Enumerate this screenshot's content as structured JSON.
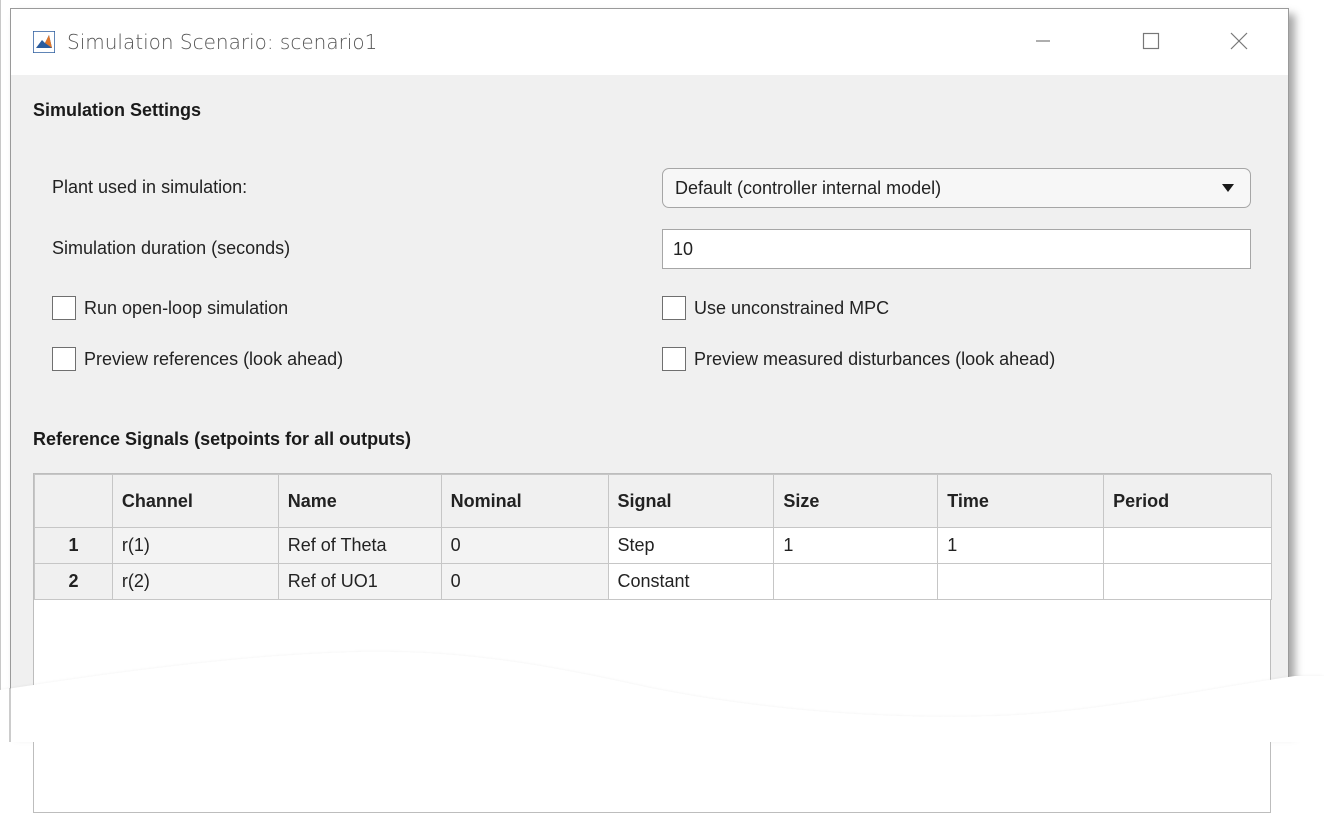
{
  "window": {
    "title": "Simulation Scenario: scenario1"
  },
  "settings": {
    "section_title": "Simulation Settings",
    "plant_label": "Plant used in simulation:",
    "plant_value": "Default (controller internal model)",
    "duration_label": "Simulation duration (seconds)",
    "duration_value": "10",
    "checkboxes": {
      "open_loop": "Run open-loop simulation",
      "unconstrained": "Use unconstrained MPC",
      "preview_refs": "Preview references (look ahead)",
      "preview_md": "Preview measured disturbances (look ahead)"
    }
  },
  "reference": {
    "section_title": "Reference Signals (setpoints for all outputs)",
    "columns": [
      "",
      "Channel",
      "Name",
      "Nominal",
      "Signal",
      "Size",
      "Time",
      "Period"
    ],
    "rows": [
      [
        "1",
        "r(1)",
        "Ref of Theta",
        "0",
        "Step",
        "1",
        "1",
        ""
      ],
      [
        "2",
        "r(2)",
        "Ref of UO1",
        "0",
        "Constant",
        "",
        "",
        ""
      ]
    ]
  },
  "icons": {
    "app": "matlab-logo-icon",
    "minimize": "minimize-icon",
    "maximize": "maximize-icon",
    "close": "close-icon",
    "dropdown": "triangle-down-icon"
  }
}
